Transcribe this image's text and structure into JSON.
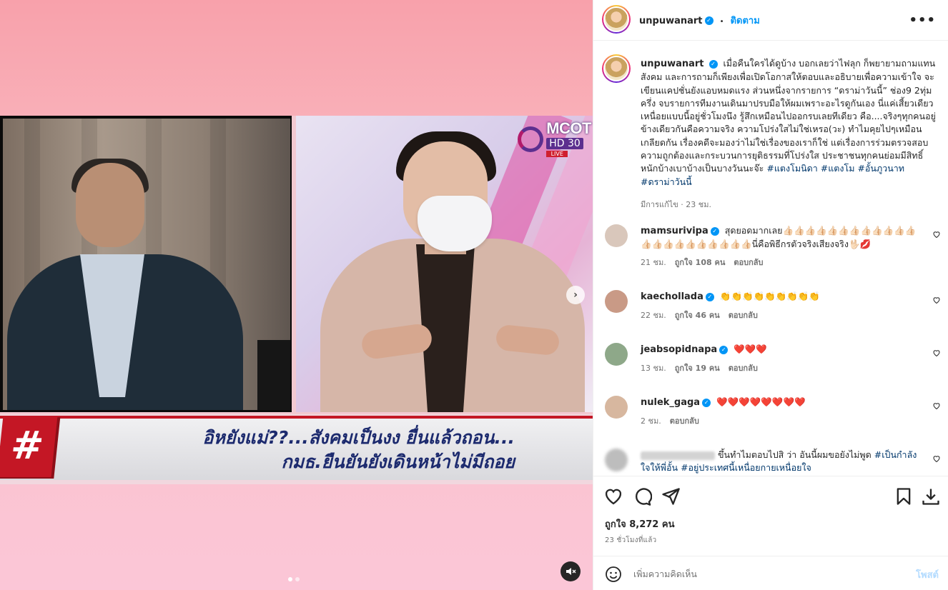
{
  "post": {
    "author": "unpuwanart",
    "follow_label": "ติดตาม",
    "bullet": "•",
    "more_label": "•••",
    "caption_text": "เมื่อคืนใครได้ดูบ้าง บอกเลยว่าไฟลุก ก็พยายามถามแทนสังคม และการถามก็เพียงเพื่อเปิดโอกาสให้ตอบและอธิบายเพื่อความเข้าใจ จะเขียนแคปชั่นยังแอบหมดแรง ส่วนหนึ่งจากรายการ “ดราม่าวันนี้” ช่อง9 2ทุ่มครึ่ง จบรายการทีมงานเดินมาปรบมือให้ผมเพราะอะไรดูกันเอง นี่แค่เสี้ยวเดียว เหนื่อยแบบนี้อยู่ชั่วโมงนึง รู้สึกเหมือนไปออกรบเลยทีเดียว คือ....จริงๆทุกคนอยู่ข้างเดียวกันคือความจริง ความโปร่งใสไม่ใช่เหรอ(วะ) ทำไมคุยไปๆเหมือนเกลียดกัน เรื่องคดีจะมองว่าไม่ใช่เรื่องของเราก็ใช่ แต่เรื่องการร่วมตรวจสอบความถูกต้องและกระบวนการยุติธรรมที่โปร่งใส ประชาชนทุกคนย่อมมีสิทธิ์ หนักบ้างเบาบ้างเป็นบางวันนะจ๊ะ",
    "hashtags": [
      "#แตงโมนิดา",
      "#แตงโม",
      "#อั้นภูวนาท",
      "#ดราม่าวันนี้"
    ],
    "edited_label": "มีการแก้ไข · 23 ชม.",
    "likes_label": "ถูกใจ 8,272 คน",
    "time_ago": "23 ชั่วโมงที่แล้ว",
    "comment_placeholder": "เพิ่มความคิดเห็น",
    "post_label": "โพสต์"
  },
  "media": {
    "channel_logo": "MCOT",
    "channel_sub": "HD 30",
    "live_tag": "LIVE",
    "hash_symbol": "#",
    "headline_line1": "อิหยังแม่??...สังคมเป็นงง ยื่นแล้วถอน...",
    "headline_line2": "กมธ.ยืนยันยังเดินหน้าไม่มีถอย",
    "next_icon": "›",
    "slide_count": 2,
    "active_slide": 1
  },
  "comments": [
    {
      "user": "mamsurivipa",
      "text": "สุดยอดมากเลย👍🏻👍🏻👍🏻👍🏻👍🏻👍🏻👍🏻👍🏻👍🏻👍🏻👍🏻👍🏻👍🏻👍🏻👍🏻👍🏻👍🏻👍🏻👍🏻👍🏻👍🏻👍🏻นี่คือพิธีกรตัวจริงเสียงจริง🖖🏻💋",
      "time": "21 ชม.",
      "likes": "ถูกใจ 108 คน",
      "reply": "ตอบกลับ",
      "avatar_color": "#d9c7bb"
    },
    {
      "user": "kaechollada",
      "text": "👏👏👏👏👏👏👏👏👏",
      "time": "22 ชม.",
      "likes": "ถูกใจ 46 คน",
      "reply": "ตอบกลับ",
      "avatar_color": "#c99a86"
    },
    {
      "user": "jeabsopidnapa",
      "text": "❤️❤️❤️",
      "time": "13 ชม.",
      "likes": "ถูกใจ 19 คน",
      "reply": "ตอบกลับ",
      "avatar_color": "#8ea889"
    },
    {
      "user": "nulek_gaga",
      "text": "❤️❤️❤️❤️❤️❤️❤️❤️",
      "time": "2 ชม.",
      "likes": "",
      "reply": "ตอบกลับ",
      "avatar_color": "#d7b79f"
    },
    {
      "user": "",
      "text": "ขึ้นทำไมตอบไปสิ ว่า อันนี้ผมขอยังไม่พูด",
      "hashtags": [
        "#เป็นกำลังใจให้พี่อั้น",
        "#อยู่ประเทศนี้เหนื่อยกายเหนื่อยใจ"
      ],
      "avatar_color": "#bdbdbd"
    }
  ],
  "colors": {
    "accent": "#0095f6",
    "tag": "#00376b",
    "muted": "#737373",
    "banner_red": "#c41725",
    "headline_blue": "#1c2a6e"
  }
}
